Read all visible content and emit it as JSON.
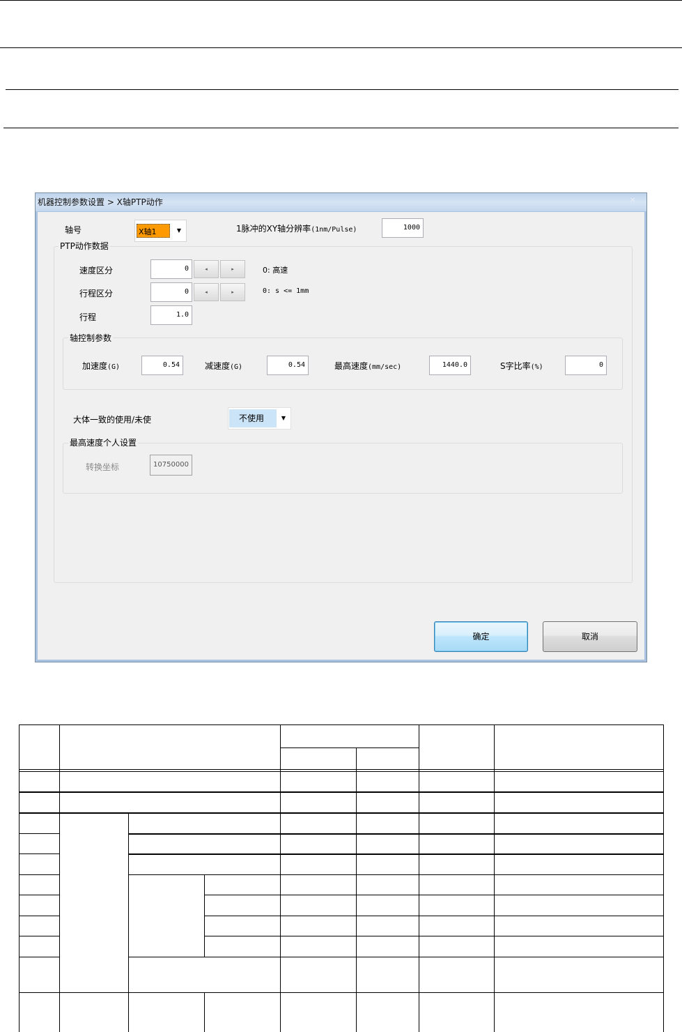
{
  "window": {
    "title": "机器控制参数设置 > X轴PTP动作",
    "close_glyph": "✕"
  },
  "axis": {
    "label": "轴号",
    "value": "X轴1",
    "arrow": "▼"
  },
  "resolution": {
    "label": "1脉冲的XY轴分辨率",
    "unit": "(1nm/Pulse)",
    "value": "1000"
  },
  "ptp_group": {
    "title": "PTP动作数据",
    "speed_class": {
      "label": "速度区分",
      "value": "0",
      "note": "0: 高速"
    },
    "stroke_class": {
      "label": "行程区分",
      "value": "0",
      "note": "0: s <= 1mm"
    },
    "stroke": {
      "label": "行程",
      "value": "1.0"
    },
    "spin_left": "◂",
    "spin_right": "▸"
  },
  "axis_ctrl": {
    "title": "轴控制参数",
    "accel": {
      "label": "加速度",
      "unit": "(G)",
      "value": "0.54"
    },
    "decel": {
      "label": "减速度",
      "unit": "(G)",
      "value": "0.54"
    },
    "max_speed": {
      "label": "最高速度",
      "unit": "(mm/sec)",
      "value": "1440.0"
    },
    "s_ratio": {
      "label": "S字比率",
      "unit": "(%)",
      "value": "0"
    }
  },
  "consistency": {
    "label": "大体一致的使用/未使",
    "value": "不使用",
    "arrow": "▼"
  },
  "max_speed_group": {
    "title": "最高速度个人设置",
    "convert_label": "转换坐标",
    "convert_value": "10750000"
  },
  "buttons": {
    "ok": "确定",
    "cancel": "取消"
  }
}
